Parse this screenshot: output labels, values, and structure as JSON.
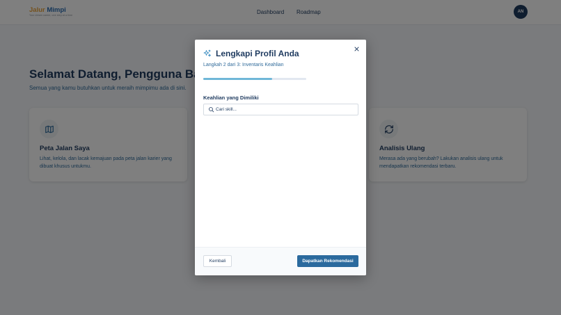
{
  "header": {
    "logo_part1": "Jalur",
    "logo_part2": "Mimpi",
    "logo_tagline": "Your dream career, one step at a time",
    "nav": [
      "Dashboard",
      "Roadmap"
    ],
    "avatar_initials": "AN"
  },
  "main": {
    "welcome_title": "Selamat Datang, Pengguna Baru",
    "welcome_subtitle": "Semua yang kamu butuhkan untuk meraih mimpimu ada di sini.",
    "cards": [
      {
        "icon": "map-icon",
        "title": "Peta Jalan Saya",
        "description": "Lihat, kelola, dan lacak kemajuan pada peta jalan karier yang dibuat khusus untukmu."
      },
      {
        "icon": "refresh-icon",
        "title": "Analisis Ulang",
        "description": "Merasa ada yang berubah? Lakukan analisis ulang untuk mendapatkan rekomendasi terbaru."
      }
    ]
  },
  "modal": {
    "title": "Lengkapi Profil Anda",
    "step_text": "Langkah 2 dari 3: Inventaris Keahlian",
    "progress": 0.667,
    "skills_label": "Keahlian yang Dimiliki",
    "search_placeholder": "Cari skill...",
    "search_value": "",
    "back_label": "Kembali",
    "submit_label": "Dapatkan Rekomendasi"
  },
  "colors": {
    "primary": "#1e3a5f",
    "accent": "#2b6a9e",
    "progress": "#6fb7d8",
    "logo_orange": "#e8a33d"
  }
}
